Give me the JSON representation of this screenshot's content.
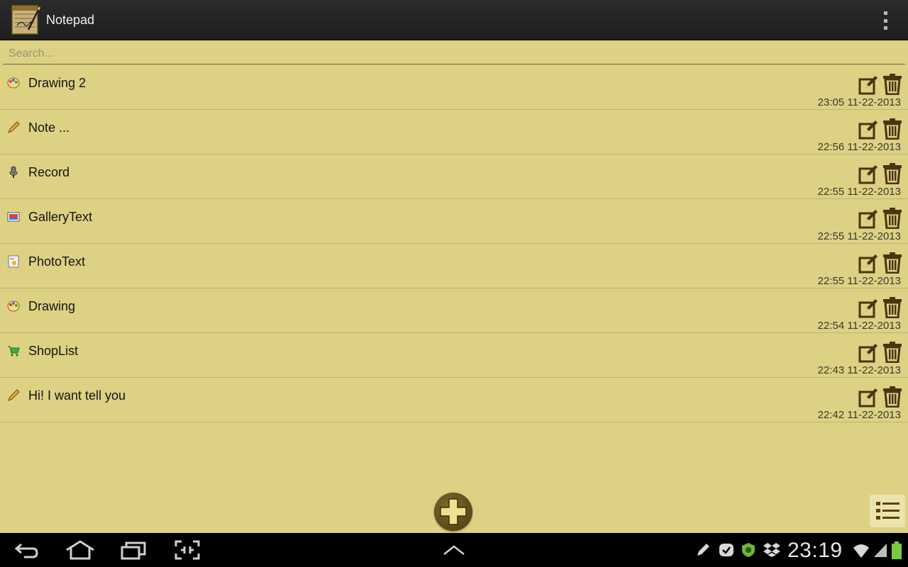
{
  "app": {
    "title": "Notepad"
  },
  "search": {
    "placeholder": "Search..."
  },
  "notes": [
    {
      "title": "Drawing 2",
      "type": "drawing",
      "timestamp": "23:05 11-22-2013"
    },
    {
      "title": "Note ...",
      "type": "text",
      "timestamp": "22:56 11-22-2013"
    },
    {
      "title": "Record",
      "type": "audio",
      "timestamp": "22:55 11-22-2013"
    },
    {
      "title": "GalleryText",
      "type": "gallery",
      "timestamp": "22:55 11-22-2013"
    },
    {
      "title": "PhotoText",
      "type": "photo",
      "timestamp": "22:55 11-22-2013"
    },
    {
      "title": "Drawing",
      "type": "drawing",
      "timestamp": "22:54 11-22-2013"
    },
    {
      "title": "ShopList",
      "type": "shoplist",
      "timestamp": "22:43 11-22-2013"
    },
    {
      "title": "Hi! I want tell you",
      "type": "text",
      "timestamp": "22:42 11-22-2013"
    }
  ],
  "status_bar": {
    "time": "23:19"
  },
  "colors": {
    "background": "#DDD184",
    "action_bar": "#222222",
    "icon_brown": "#4a3410"
  }
}
